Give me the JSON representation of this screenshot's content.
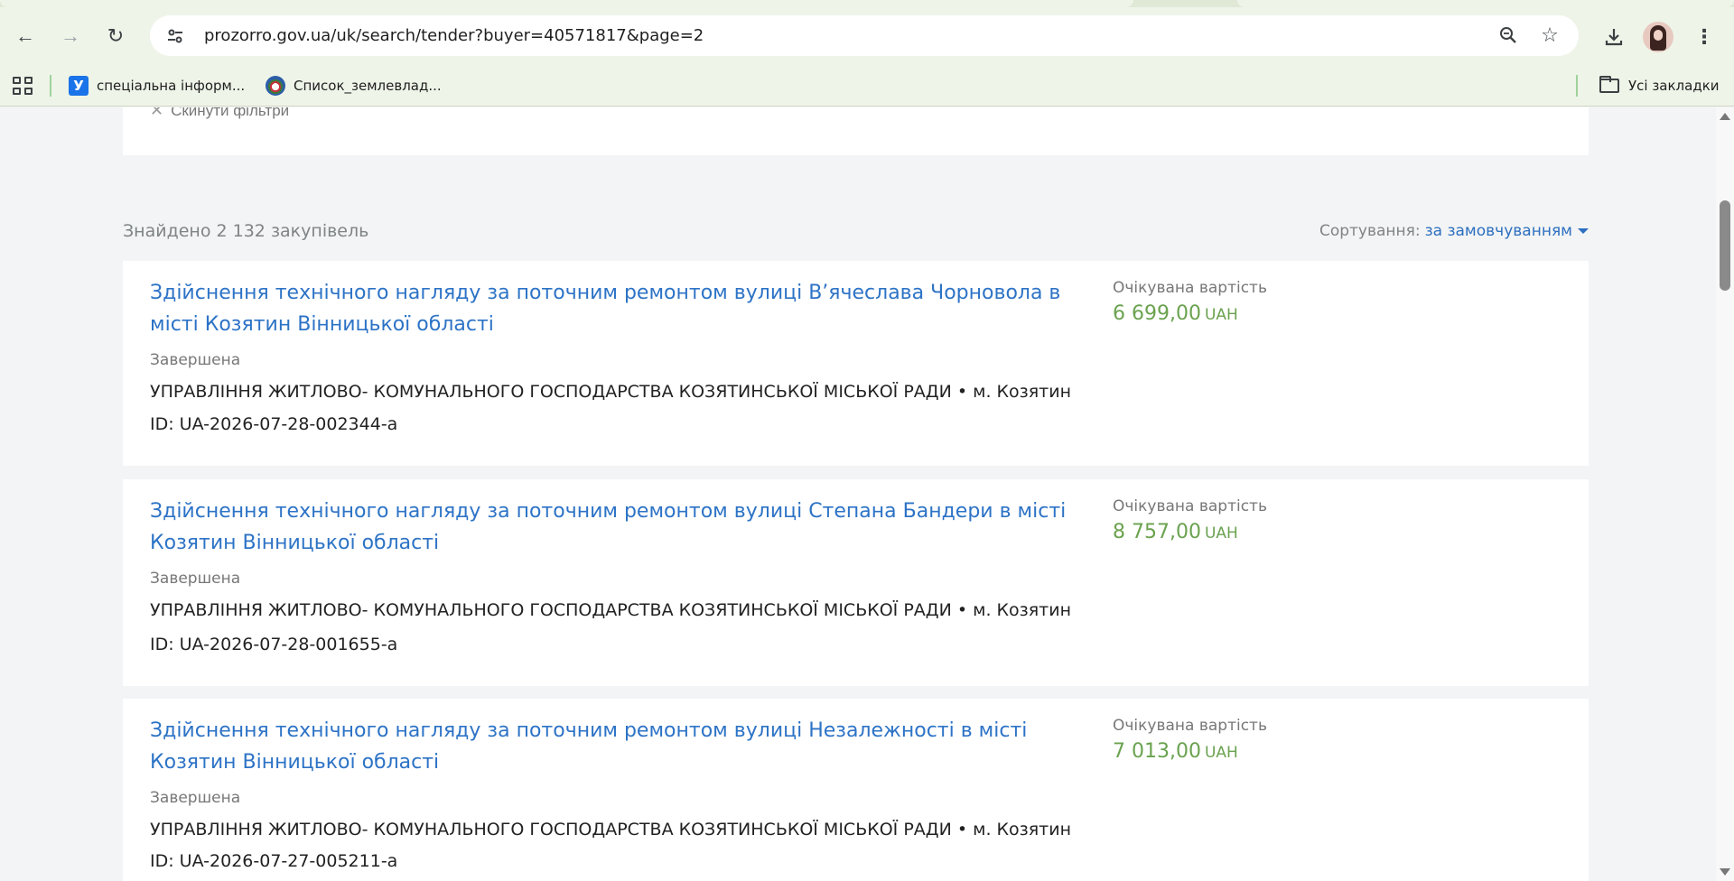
{
  "browser": {
    "url": "prozorro.gov.ua/uk/search/tender?buyer=40571817&page=2",
    "bookmarks": [
      {
        "label": "спеціальна інформ..."
      },
      {
        "label": "Список_землевлад..."
      }
    ],
    "all_bookmarks_label": "Усі закладки"
  },
  "page": {
    "reset_filters_label": "Скинути фільтри",
    "found_text": "Знайдено 2 132 закупівель",
    "sort_label": "Сортування:",
    "sort_value": "за замовчуванням",
    "tenders": [
      {
        "title": "Здійснення технічного нагляду за поточним ремонтом вулиці В’ячеслава Чорновола в мі­сті Козятин Вінницької області",
        "status": "Завершена",
        "buyer": "УПРАВЛІННЯ ЖИТЛОВО- КОМУНАЛЬНОГО ГОСПОДАРСТВА КОЗЯТИНСЬКОЇ МІСЬКОЇ РАДИ • м. Козятин",
        "id": "ID: UA-2026-07-28-002344-a",
        "expected_label": "Очікувана вартість",
        "amount": "6 699,00",
        "currency": "UAH"
      },
      {
        "title": "Здійснення технічного нагляду за поточним ремонтом вулиці Степана Бандери в місті Ко­зятин Вінницької області",
        "status": "Завершена",
        "buyer": "УПРАВЛІННЯ ЖИТЛОВО- КОМУНАЛЬНОГО ГОСПОДАРСТВА КОЗЯТИНСЬКОЇ МІСЬКОЇ РАДИ • м. Козятин",
        "id": "ID: UA-2026-07-28-001655-a",
        "expected_label": "Очікувана вартість",
        "amount": "8 757,00",
        "currency": "UAH"
      },
      {
        "title": "Здійснення технічного нагляду за поточним ремонтом вулиці Незалежності в місті Козя­тин Вінницької області",
        "status": "Завершена",
        "buyer": "УПРАВЛІННЯ ЖИТЛОВО- КОМУНАЛЬНОГО ГОСПОДАРСТВА КОЗЯТИНСЬКОЇ МІСЬКОЇ РАДИ • м. Козятин",
        "id": "ID: UA-2026-07-27-005211-a",
        "expected_label": "Очікувана вартість",
        "amount": "7 013,00",
        "currency": "UAH"
      }
    ]
  }
}
